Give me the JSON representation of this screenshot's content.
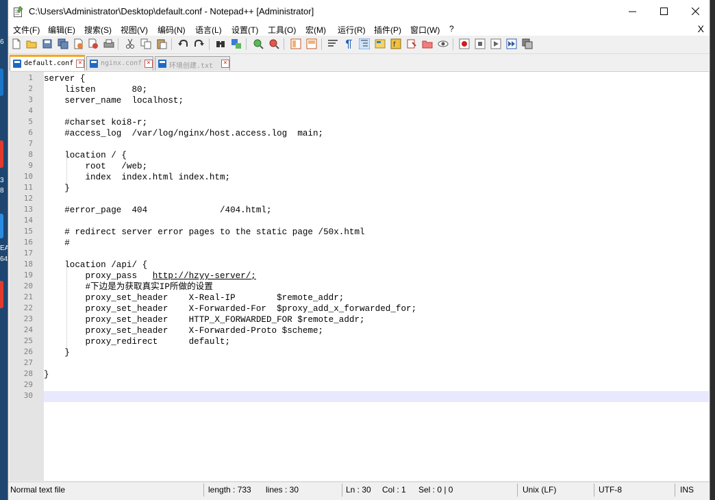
{
  "window": {
    "title": "C:\\Users\\Administrator\\Desktop\\default.conf - Notepad++ [Administrator]"
  },
  "menu": [
    "文件(F)",
    "编辑(E)",
    "搜索(S)",
    "视图(V)",
    "编码(N)",
    "语言(L)",
    "设置(T)",
    "工具(O)",
    "宏(M)",
    "运行(R)",
    "插件(P)",
    "窗口(W)",
    "?"
  ],
  "menu_close": "X",
  "tabs": [
    {
      "label": "default.conf",
      "active": true
    },
    {
      "label": "nginx.conf",
      "active": false
    },
    {
      "label": "环境创建.txt",
      "active": false
    }
  ],
  "editor": {
    "line_numbers": [
      "1",
      "2",
      "3",
      "4",
      "5",
      "6",
      "7",
      "8",
      "9",
      "10",
      "11",
      "12",
      "13",
      "14",
      "15",
      "16",
      "17",
      "18",
      "19",
      "20",
      "21",
      "22",
      "23",
      "24",
      "25",
      "26",
      "27",
      "28",
      "29",
      "30"
    ],
    "lines": [
      "server {",
      "    listen       80;",
      "    server_name  localhost;",
      "",
      "    #charset koi8-r;",
      "    #access_log  /var/log/nginx/host.access.log  main;",
      "",
      "    location / {",
      "        root   /web;",
      "        index  index.html index.htm;",
      "    }",
      "",
      "    #error_page  404              /404.html;",
      "",
      "    # redirect server error pages to the static page /50x.html",
      "    #",
      "",
      "    location /api/ {",
      "        proxy_pass   ",
      "        #下边是为获取真实IP所做的设置",
      "        proxy_set_header    X-Real-IP        $remote_addr;",
      "        proxy_set_header    X-Forwarded-For  $proxy_add_x_forwarded_for;",
      "        proxy_set_header    HTTP_X_FORWARDED_FOR $remote_addr;",
      "        proxy_set_header    X-Forwarded-Proto $scheme;",
      "        proxy_redirect      default;",
      "    }",
      "",
      "}",
      "",
      ""
    ],
    "url": "http://hzyy-server/;",
    "current_line": 30
  },
  "status": {
    "file_type": "Normal text file",
    "length": "length : 733",
    "lines": "lines : 30",
    "ln": "Ln : 30",
    "col": "Col : 1",
    "sel": "Sel : 0 | 0",
    "eol": "Unix (LF)",
    "encoding": "UTF-8",
    "mode": "INS"
  },
  "desktop_fragments": [
    "6",
    "3",
    "8",
    "EA",
    "64"
  ],
  "colors": {
    "accent_tab": "#f7a51e",
    "current_line": "#e8e8ff",
    "gutter": "#e4e4e4"
  },
  "icons": [
    "new-file-icon",
    "open-file-icon",
    "save-icon",
    "save-all-icon",
    "close-icon",
    "close-all-icon",
    "print-icon",
    "cut-icon",
    "copy-icon",
    "paste-icon",
    "undo-icon",
    "redo-icon",
    "find-icon",
    "replace-icon",
    "zoom-in-icon",
    "zoom-out-icon",
    "sync-v-icon",
    "sync-h-icon",
    "word-wrap-icon",
    "show-all-chars-icon",
    "indent-guide-icon",
    "doc-map-icon",
    "function-list-icon",
    "folder-workspace-icon",
    "monitoring-icon",
    "record-macro-icon",
    "stop-record-icon",
    "play-macro-icon",
    "run-macro-multiple-icon",
    "save-macro-icon"
  ]
}
